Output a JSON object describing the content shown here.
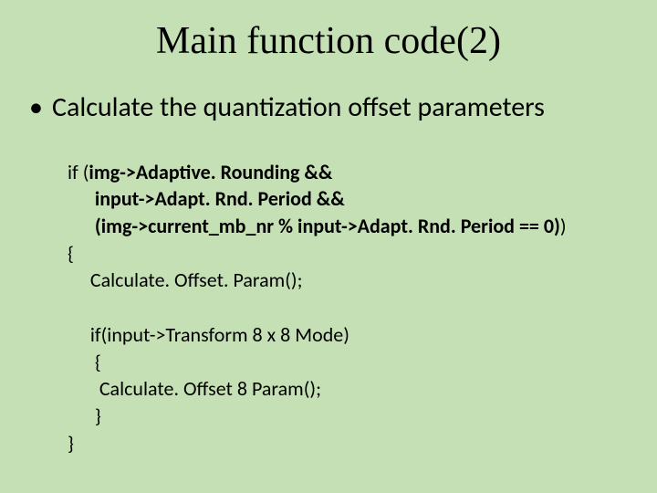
{
  "title": "Main function code(2)",
  "bullet": {
    "marker": "•",
    "text": "Calculate the quantization offset parameters"
  },
  "code": {
    "l1a": "if (",
    "l1b": "img->Adaptive. Rounding &&",
    "l2": "      input->Adapt. Rnd. Period &&",
    "l3": "      (img->current_mb_nr % input->Adapt. Rnd. Period == 0)",
    "l3b": ")",
    "l4": "{",
    "l5": "     Calculate. Offset. Param();",
    "blank": " ",
    "l6": "     if(input->Transform 8 x 8 Mode)",
    "l7": "      {",
    "l8": "       Calculate. Offset 8 Param();",
    "l9": "      }",
    "l10": "}"
  }
}
